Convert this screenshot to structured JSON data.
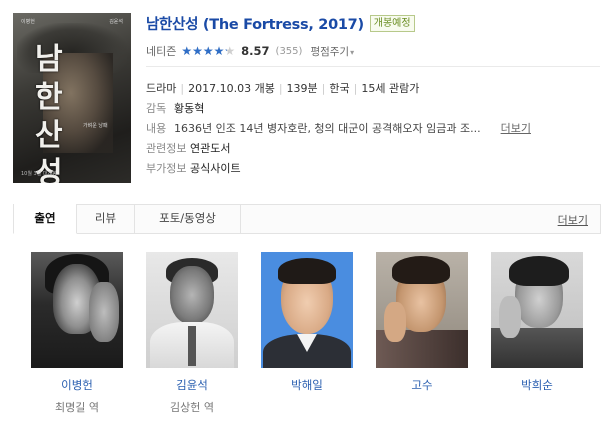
{
  "movie": {
    "title": "남한산성 (The Fortress, 2017)",
    "badge": "개봉예정",
    "poster": {
      "title_art": "남한산성",
      "top_left": "이병헌",
      "top_right": "김윤석",
      "tagline": "가벼운 낭패",
      "date_text": "10월 3일 대개봉"
    }
  },
  "rating": {
    "label": "네티즌",
    "score": "8.57",
    "score_fraction": 0.857,
    "count": "(355)",
    "action_label": "평점주기",
    "star_color": "#2f6ec7"
  },
  "info": {
    "genre": "드라마",
    "release": "2017.10.03 개봉",
    "runtime": "139분",
    "country": "한국",
    "age": "15세 관람가",
    "director_label": "감독",
    "director": "황동혁",
    "summary_label": "내용",
    "summary": "1636년 인조 14년 병자호란, 청의 대군이 공격해오자 임금과 조...",
    "more_label": "더보기",
    "related_label": "관련정보",
    "related": "연관도서",
    "extra_label": "부가정보",
    "extra": "공식사이트"
  },
  "tabs": {
    "items": [
      {
        "label": "출연"
      },
      {
        "label": "리뷰"
      },
      {
        "label": "포토/동영상"
      }
    ],
    "more_label": "더보기"
  },
  "cast": [
    {
      "name": "이병헌",
      "role": "최명길 역"
    },
    {
      "name": "김윤석",
      "role": "김상헌 역"
    },
    {
      "name": "박해일",
      "role": ""
    },
    {
      "name": "고수",
      "role": ""
    },
    {
      "name": "박희순",
      "role": ""
    }
  ]
}
